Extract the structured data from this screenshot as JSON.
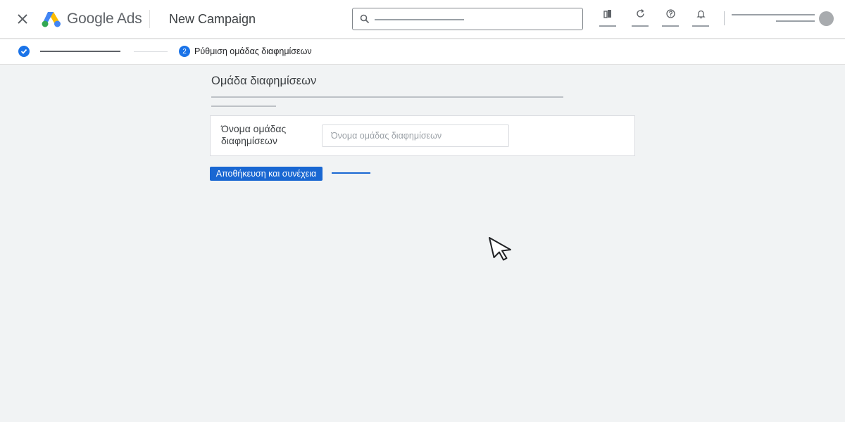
{
  "header": {
    "brand": "Google Ads",
    "page_title": "New Campaign",
    "tools": [
      {
        "icon": "reports-icon"
      },
      {
        "icon": "refresh-icon"
      },
      {
        "icon": "help-icon"
      },
      {
        "icon": "notifications-icon"
      }
    ]
  },
  "stepper": {
    "step2_number": "2",
    "step2_label": "Ρύθμιση ομάδας διαφημίσεων"
  },
  "main": {
    "section_title": "Ομάδα διαφημίσεων",
    "field_label": "Όνομα ομάδας διαφημίσεων",
    "field_placeholder": "Όνομα ομάδας διαφημίσεων",
    "field_value": "",
    "save_label": "Αποθήκευση και συνέχεια"
  },
  "colors": {
    "accent": "#1a73e8",
    "button": "#1967d2",
    "background": "#f1f3f4"
  }
}
